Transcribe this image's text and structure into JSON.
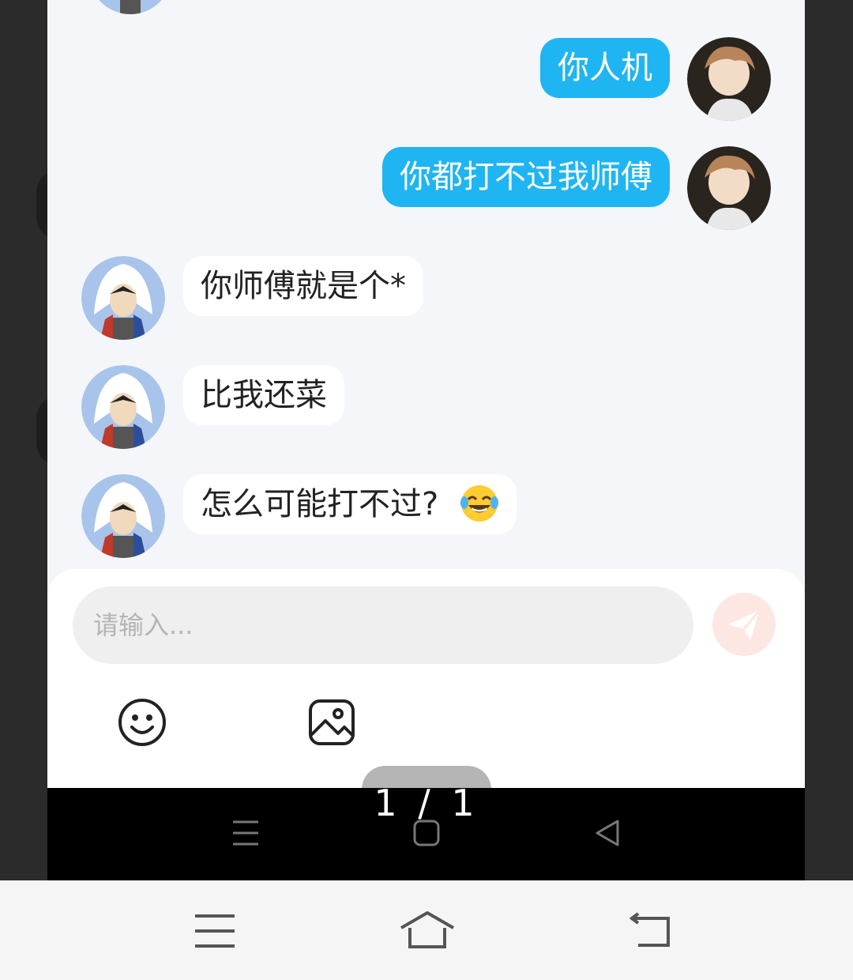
{
  "messages": [
    {
      "side": "out",
      "text": "你人机"
    },
    {
      "side": "out",
      "text": "你都打不过我师傅"
    },
    {
      "side": "in",
      "text": "你师傅就是个*"
    },
    {
      "side": "in",
      "text": "比我还菜"
    },
    {
      "side": "in",
      "text": "怎么可能打不过?",
      "emoji": "laughing-tears-emoji"
    }
  ],
  "composer": {
    "placeholder": "请输入...",
    "send_icon": "send-icon",
    "tools": [
      "emoji-icon",
      "image-icon"
    ]
  },
  "viewer": {
    "page_indicator": "1 / 1"
  },
  "colors": {
    "outgoing_bubble": "#1fb5f2",
    "incoming_bubble": "#ffffff",
    "chat_background": "#f4f6f9",
    "send_button": "#fde7e3"
  }
}
